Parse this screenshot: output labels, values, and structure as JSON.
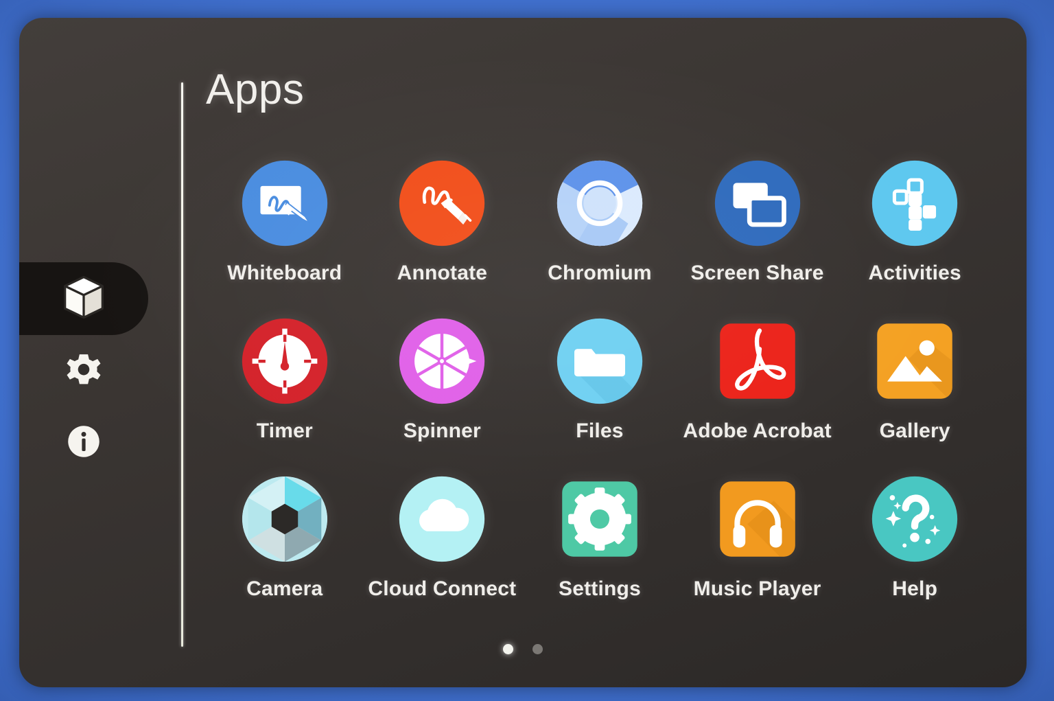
{
  "window": {
    "background_color": "#3f6ecb",
    "panel_color": "#3b3633"
  },
  "sidebar": {
    "items": [
      {
        "id": "apps",
        "icon": "cube-icon",
        "label": "Apps",
        "active": true
      },
      {
        "id": "settings",
        "icon": "gear-icon",
        "label": "Settings",
        "active": false
      },
      {
        "id": "info",
        "icon": "info-icon",
        "label": "Info",
        "active": false
      }
    ]
  },
  "header": {
    "title": "Apps"
  },
  "apps": [
    {
      "name": "Whiteboard",
      "icon": "whiteboard-icon",
      "shape": "circle",
      "color": "#4a8de0"
    },
    {
      "name": "Annotate",
      "icon": "annotate-icon",
      "shape": "circle",
      "color": "#f24e1a"
    },
    {
      "name": "Chromium",
      "icon": "chromium-icon",
      "shape": "circle",
      "color": "#9dc3f5"
    },
    {
      "name": "Screen Share",
      "icon": "screen-share-icon",
      "shape": "circle",
      "color": "#2f6bbd"
    },
    {
      "name": "Activities",
      "icon": "activities-icon",
      "shape": "circle",
      "color": "#5ec8ef"
    },
    {
      "name": "Timer",
      "icon": "timer-icon",
      "shape": "circle",
      "color": "#d4222a"
    },
    {
      "name": "Spinner",
      "icon": "spinner-icon",
      "shape": "circle",
      "color": "#e060e8"
    },
    {
      "name": "Files",
      "icon": "files-icon",
      "shape": "circle",
      "color": "#6fd0f2"
    },
    {
      "name": "Adobe Acrobat",
      "icon": "adobe-acrobat-icon",
      "shape": "square",
      "color": "#ec2219"
    },
    {
      "name": "Gallery",
      "icon": "gallery-icon",
      "shape": "square",
      "color": "#f4a123"
    },
    {
      "name": "Camera",
      "icon": "camera-icon",
      "shape": "circle",
      "color": "#9ad7dd"
    },
    {
      "name": "Cloud Connect",
      "icon": "cloud-connect-icon",
      "shape": "circle",
      "color": "#b4f1f4"
    },
    {
      "name": "Settings",
      "icon": "settings-gear-icon",
      "shape": "square",
      "color": "#4ec9a5"
    },
    {
      "name": "Music Player",
      "icon": "music-player-icon",
      "shape": "square",
      "color": "#f29a1f"
    },
    {
      "name": "Help",
      "icon": "help-icon",
      "shape": "circle",
      "color": "#49c7c2"
    }
  ],
  "pagination": {
    "pages": 2,
    "current_page": 1,
    "dots": [
      {
        "active": true
      },
      {
        "active": false
      }
    ]
  }
}
